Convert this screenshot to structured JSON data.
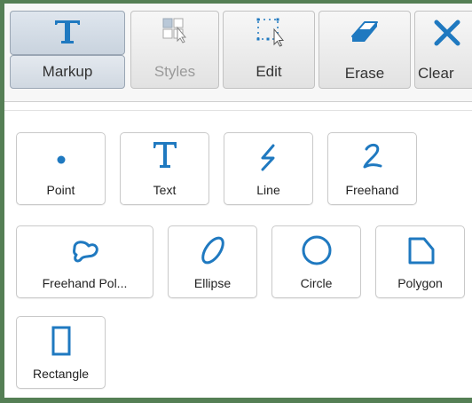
{
  "toolbar": {
    "markup_label": "Markup",
    "styles_label": "Styles",
    "edit_label": "Edit",
    "erase_label": "Erase",
    "clear_label": "Clear"
  },
  "tools": {
    "point": "Point",
    "text": "Text",
    "line": "Line",
    "freehand": "Freehand",
    "freehand_polygon": "Freehand Pol...",
    "ellipse": "Ellipse",
    "circle": "Circle",
    "polygon": "Polygon",
    "rectangle": "Rectangle"
  },
  "colors": {
    "icon_blue": "#1f79c0",
    "frame_green": "#557f55"
  }
}
